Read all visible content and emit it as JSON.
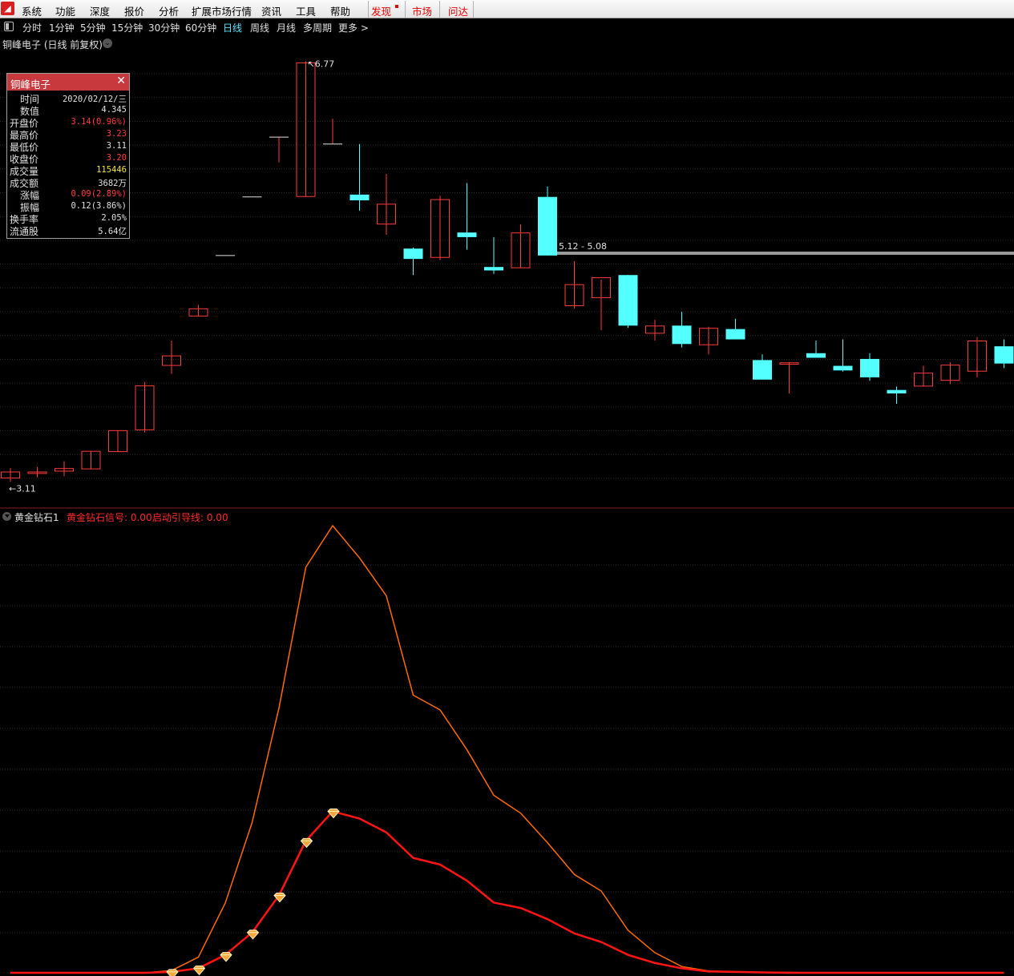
{
  "menu": {
    "logo_icon": "app-logo-icon",
    "items": [
      "系统",
      "功能",
      "深度",
      "报价",
      "分析",
      "扩展市场行情",
      "资讯",
      "工具",
      "帮助"
    ],
    "discover": "发现",
    "market": "市场",
    "wenda": "问达"
  },
  "periods": {
    "items": [
      "分时",
      "1分钟",
      "5分钟",
      "15分钟",
      "30分钟",
      "60分钟",
      "日线",
      "周线",
      "月线",
      "多周期",
      "更多 >"
    ],
    "active": "日线"
  },
  "stock": {
    "title": "铜峰电子 (日线 前复权)"
  },
  "info": {
    "name": "铜峰电子",
    "rows": [
      {
        "label": "时间",
        "value": "2020/02/12/三",
        "color": "#e0e0e0"
      },
      {
        "label": "数值",
        "value": "4.345",
        "color": "#e0e0e0"
      },
      {
        "label": "开盘价",
        "value": "3.14(0.96%)",
        "color": "#ff3b3b"
      },
      {
        "label": "最高价",
        "value": "3.23",
        "color": "#ff3b3b"
      },
      {
        "label": "最低价",
        "value": "3.11",
        "color": "#e0e0e0"
      },
      {
        "label": "收盘价",
        "value": "3.20",
        "color": "#ff3b3b"
      },
      {
        "label": "成交量",
        "value": "115446",
        "color": "#f5e33a"
      },
      {
        "label": "成交额",
        "value": "3682万",
        "color": "#e0e0e0"
      },
      {
        "label": "涨幅",
        "value": "0.09(2.89%)",
        "color": "#ff3b3b"
      },
      {
        "label": "振幅",
        "value": "0.12(3.86%)",
        "color": "#e0e0e0"
      },
      {
        "label": "换手率",
        "value": "2.05%",
        "color": "#e0e0e0"
      },
      {
        "label": "流通股",
        "value": "5.64亿",
        "color": "#e0e0e0"
      }
    ]
  },
  "chart_data": [
    {
      "type": "candlestick",
      "max_label": "6.77",
      "min_label": "3.11",
      "range_label": "5.12 - 5.08",
      "ylim": [
        3.05,
        6.85
      ],
      "up_color": "#ff3b3b",
      "down_color": "#54ffff",
      "candles": [
        {
          "o": 3.14,
          "h": 3.23,
          "l": 3.11,
          "c": 3.2
        },
        {
          "o": 3.18,
          "h": 3.24,
          "l": 3.15,
          "c": 3.2
        },
        {
          "o": 3.2,
          "h": 3.29,
          "l": 3.16,
          "c": 3.23
        },
        {
          "o": 3.22,
          "h": 3.38,
          "l": 3.22,
          "c": 3.38
        },
        {
          "o": 3.37,
          "h": 3.56,
          "l": 3.37,
          "c": 3.56
        },
        {
          "o": 3.56,
          "h": 3.98,
          "l": 3.54,
          "c": 3.95
        },
        {
          "o": 4.12,
          "h": 4.34,
          "l": 4.05,
          "c": 4.21
        },
        {
          "o": 4.55,
          "h": 4.65,
          "l": 4.55,
          "c": 4.62
        },
        {
          "o": 5.08,
          "h": 5.08,
          "l": 5.08,
          "c": 5.08
        },
        {
          "o": 5.59,
          "h": 5.59,
          "l": 5.59,
          "c": 5.59
        },
        {
          "o": 6.11,
          "h": 6.11,
          "l": 5.89,
          "c": 6.11
        },
        {
          "o": 5.59,
          "h": 6.77,
          "l": 5.59,
          "c": 6.76
        },
        {
          "o": 6.05,
          "h": 6.27,
          "l": 6.05,
          "c": 6.05
        },
        {
          "o": 5.61,
          "h": 6.05,
          "l": 5.47,
          "c": 5.56
        },
        {
          "o": 5.35,
          "h": 5.79,
          "l": 5.26,
          "c": 5.53
        },
        {
          "o": 5.14,
          "h": 5.15,
          "l": 4.91,
          "c": 5.05
        },
        {
          "o": 5.06,
          "h": 5.6,
          "l": 5.04,
          "c": 5.57
        },
        {
          "o": 5.28,
          "h": 5.71,
          "l": 5.13,
          "c": 5.24
        },
        {
          "o": 4.98,
          "h": 5.24,
          "l": 4.92,
          "c": 4.95
        },
        {
          "o": 4.97,
          "h": 5.35,
          "l": 4.97,
          "c": 5.28
        },
        {
          "o": 5.59,
          "h": 5.68,
          "l": 5.08,
          "c": 5.08
        },
        {
          "o": 4.64,
          "h": 5.03,
          "l": 4.62,
          "c": 4.83
        },
        {
          "o": 4.71,
          "h": 4.87,
          "l": 4.43,
          "c": 4.89
        },
        {
          "o": 4.91,
          "h": 4.91,
          "l": 4.45,
          "c": 4.47
        },
        {
          "o": 4.4,
          "h": 4.52,
          "l": 4.34,
          "c": 4.47
        },
        {
          "o": 4.47,
          "h": 4.59,
          "l": 4.28,
          "c": 4.31
        },
        {
          "o": 4.3,
          "h": 4.46,
          "l": 4.22,
          "c": 4.45
        },
        {
          "o": 4.44,
          "h": 4.53,
          "l": 4.36,
          "c": 4.35
        },
        {
          "o": 4.17,
          "h": 4.22,
          "l": 4.04,
          "c": 4.0
        },
        {
          "o": 4.13,
          "h": 4.15,
          "l": 3.88,
          "c": 4.15
        },
        {
          "o": 4.23,
          "h": 4.34,
          "l": 4.2,
          "c": 4.19
        },
        {
          "o": 4.12,
          "h": 4.35,
          "l": 4.07,
          "c": 4.08
        },
        {
          "o": 4.18,
          "h": 4.23,
          "l": 3.99,
          "c": 4.02
        },
        {
          "o": 3.91,
          "h": 3.94,
          "l": 3.79,
          "c": 3.88
        },
        {
          "o": 3.94,
          "h": 4.12,
          "l": 3.94,
          "c": 4.06
        },
        {
          "o": 3.99,
          "h": 4.15,
          "l": 3.96,
          "c": 4.13
        },
        {
          "o": 4.07,
          "h": 4.37,
          "l": 4.02,
          "c": 4.34
        },
        {
          "o": 4.29,
          "h": 4.35,
          "l": 4.1,
          "c": 4.14
        }
      ]
    },
    {
      "type": "line",
      "name": "黄金钻石1",
      "signal_label": "黄金钻石信号: 0.00",
      "guide_label": "启动引导线: 0.00",
      "ylim": [
        0,
        100
      ],
      "series": [
        {
          "name": "启动引导线",
          "color": "#ff6a00",
          "values": [
            0,
            0,
            0,
            0,
            0,
            0,
            0.5,
            3.5,
            15.6,
            33.6,
            59.2,
            90.7,
            100,
            92.8,
            84.3,
            62.1,
            58.8,
            49.9,
            39.7,
            35.7,
            29.1,
            22.0,
            18.3,
            9.5,
            4.5,
            1.4,
            0.4,
            0.2,
            0.1,
            0.1,
            0,
            0,
            0,
            0,
            0,
            0,
            0,
            0
          ]
        },
        {
          "name": "黄金钻石信号",
          "color": "#ff1414",
          "values": [
            0,
            0,
            0,
            0,
            0,
            0,
            0.2,
            1.0,
            4.0,
            9.0,
            17.3,
            29.5,
            36.1,
            34.5,
            31.4,
            25.7,
            24.2,
            20.6,
            15.7,
            14.5,
            12.0,
            8.8,
            6.9,
            4.0,
            2.2,
            1.0,
            0.3,
            0.2,
            0.1,
            0,
            0,
            0,
            0,
            0,
            0,
            0,
            0,
            0
          ]
        }
      ],
      "diamond_indices": [
        6,
        7,
        8,
        9,
        10,
        11,
        12
      ]
    }
  ]
}
